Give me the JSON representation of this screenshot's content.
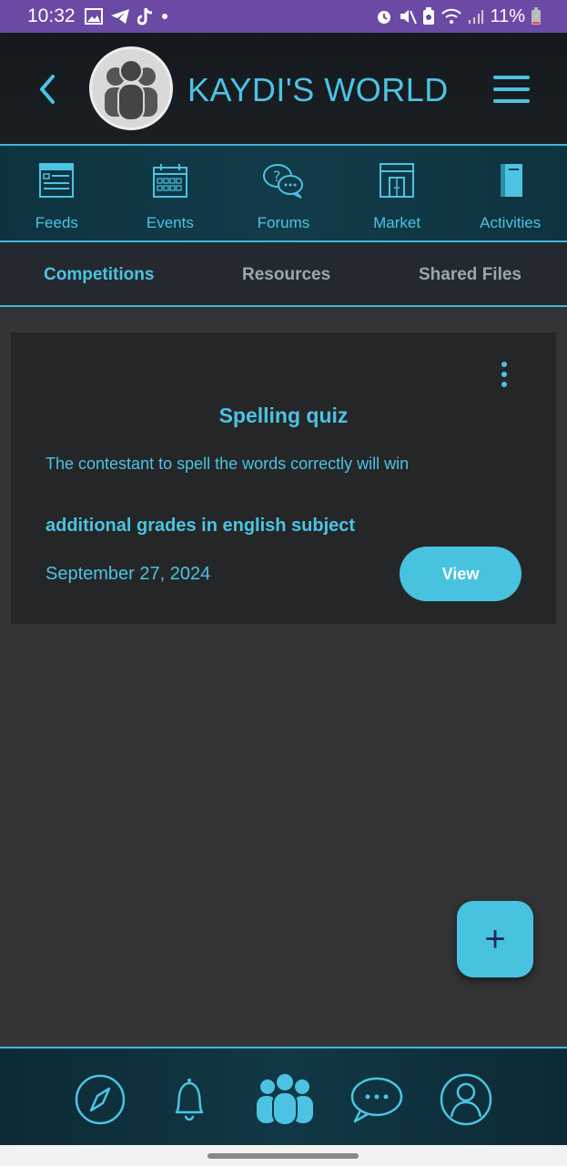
{
  "status_bar": {
    "time": "10:32",
    "battery": "11%",
    "left_icons": [
      "gallery-icon",
      "telegram-icon",
      "tiktok-icon",
      "dot-icon"
    ],
    "right_icons": [
      "alarm-icon",
      "mute-icon",
      "battery-saver-icon",
      "wifi-icon",
      "signal-icon",
      "battery-icon"
    ]
  },
  "header": {
    "title": "KAYDI'S WORLD",
    "back_icon": "chevron-left-icon",
    "logo_icon": "group-avatar-icon",
    "menu_icon": "hamburger-icon"
  },
  "top_nav": {
    "items": [
      {
        "label": "Feeds",
        "icon": "feeds-icon"
      },
      {
        "label": "Events",
        "icon": "calendar-icon"
      },
      {
        "label": "Forums",
        "icon": "forums-icon"
      },
      {
        "label": "Market",
        "icon": "market-icon"
      },
      {
        "label": "Activities",
        "icon": "book-icon"
      }
    ]
  },
  "tabs": {
    "items": [
      {
        "label": "Competitions",
        "active": true
      },
      {
        "label": "Resources",
        "active": false
      },
      {
        "label": "Shared Files",
        "active": false
      }
    ]
  },
  "competition": {
    "title": "Spelling quiz",
    "description": "The contestant to spell the words correctly will win",
    "prize": "additional grades in english subject",
    "date": "September 27, 2024",
    "view_label": "View"
  },
  "fab": {
    "label": "+"
  },
  "bottom_nav": {
    "items": [
      "compass-icon",
      "bell-icon",
      "community-icon",
      "chat-icon",
      "profile-icon"
    ]
  },
  "colors": {
    "accent": "#4cc3e3",
    "status_bar": "#6b4aa6",
    "background": "#333436",
    "card": "#252627"
  }
}
